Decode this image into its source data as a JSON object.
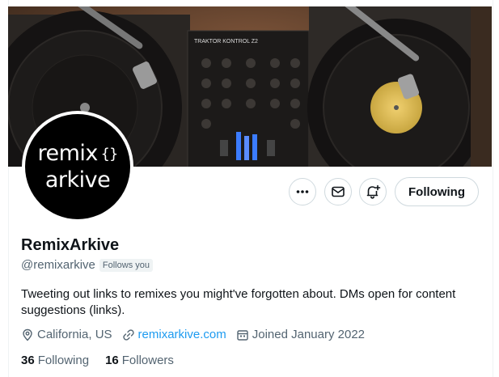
{
  "profile": {
    "banner_alt": "DJ turntables and mixer",
    "avatar_line1": "remix",
    "avatar_brace": "{}",
    "avatar_line2": "arkive",
    "mixer_brand": "TRAKTOR KONTROL Z2",
    "name": "RemixArkive",
    "handle": "@remixarkive",
    "follows_you": "Follows you",
    "bio": "Tweeting out links to remixes you might've forgotten about.  DMs open for content suggestions (links).",
    "location": "California, US",
    "website": "remixarkive.com",
    "joined": "Joined January 2022",
    "following_count": "36",
    "following_label": "Following",
    "followers_count": "16",
    "followers_label": "Followers"
  },
  "actions": {
    "more_icon": "more-icon",
    "message_icon": "mail-icon",
    "notify_icon": "bell-plus-icon",
    "follow_label": "Following"
  },
  "colors": {
    "link": "#1d9bf0",
    "muted": "#536471",
    "text": "#0f1419"
  }
}
